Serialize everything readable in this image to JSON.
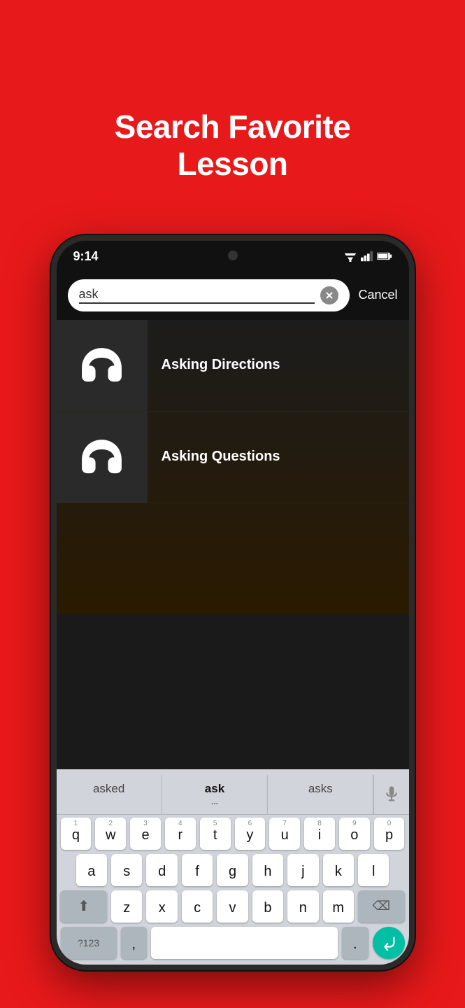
{
  "header": {
    "title": "Search Favorite\nLesson"
  },
  "status_bar": {
    "time": "9:14"
  },
  "search": {
    "value": "ask",
    "clear_label": "✕",
    "cancel_label": "Cancel"
  },
  "results": [
    {
      "id": 1,
      "label": "Asking Directions"
    },
    {
      "id": 2,
      "label": "Asking Questions"
    }
  ],
  "autocomplete": {
    "words": [
      "asked",
      "ask",
      "asks"
    ],
    "active_index": 1,
    "dots": "..."
  },
  "keyboard": {
    "rows": [
      [
        "q",
        "w",
        "e",
        "r",
        "t",
        "y",
        "u",
        "i",
        "o",
        "p"
      ],
      [
        "a",
        "s",
        "d",
        "f",
        "g",
        "h",
        "j",
        "k",
        "l"
      ],
      [
        "z",
        "x",
        "c",
        "v",
        "b",
        "n",
        "m"
      ]
    ],
    "numbers": [
      "1",
      "2",
      "3",
      "4",
      "5",
      "6",
      "7",
      "8",
      "9",
      "0"
    ],
    "special_left": "?123",
    "space_label": "",
    "period": "."
  }
}
